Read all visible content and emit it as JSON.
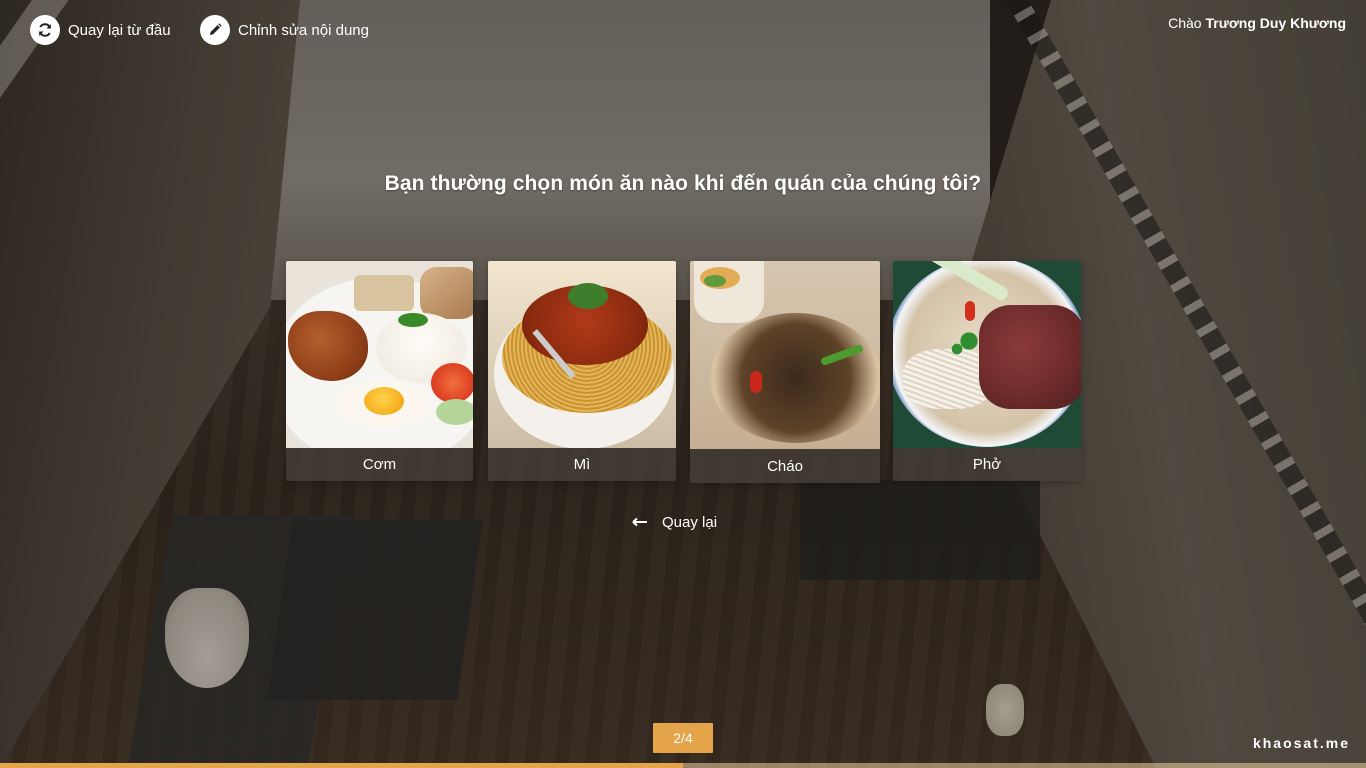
{
  "topbar": {
    "restart_label": "Quay lại từ đầu",
    "edit_label": "Chỉnh sửa nội dung",
    "greeting_prefix": "Chào",
    "user_name": "Trương Duy Khương"
  },
  "question": "Bạn thường chọn món ăn nào khi đến quán của chúng tôi?",
  "options": [
    {
      "label": "Cơm"
    },
    {
      "label": "Mì"
    },
    {
      "label": "Cháo"
    },
    {
      "label": "Phở"
    }
  ],
  "back_label": "Quay lại",
  "pagination": {
    "text": "2/4",
    "progress": 0.5
  },
  "brand": "khaosat.me",
  "colors": {
    "accent": "#e6a44a"
  },
  "icons": {
    "restart": "refresh-icon",
    "edit": "pencil-icon",
    "back": "arrow-left-icon"
  }
}
